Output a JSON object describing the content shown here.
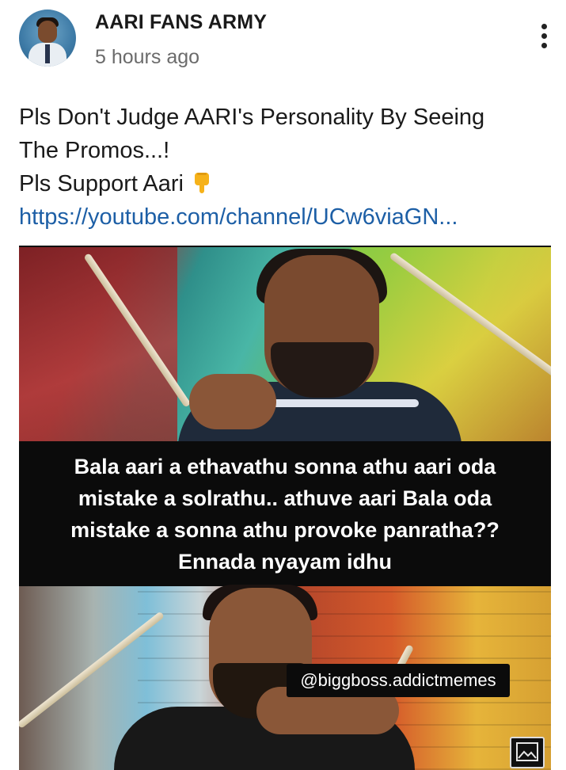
{
  "post": {
    "channel_name": "AARI FANS ARMY",
    "time_ago": "5 hours ago",
    "text_lines": [
      "Pls Don't Judge AARI's Personality By Seeing",
      "The Promos...!",
      "Pls Support Aari"
    ],
    "emoji_icon": "pointing-down-hand-emoji",
    "link": "https://youtube.com/channel/UCw6viaGN..."
  },
  "image": {
    "caption_lines": [
      "Bala aari a ethavathu sonna athu aari oda",
      "mistake a solrathu.. athuve aari Bala oda",
      "mistake a sonna athu provoke panratha??",
      "Ennada nyayam idhu"
    ],
    "watermark": "@biggboss.addictmemes"
  },
  "icons": {
    "menu": "more-vertical-icon",
    "image_badge": "image-icon"
  }
}
